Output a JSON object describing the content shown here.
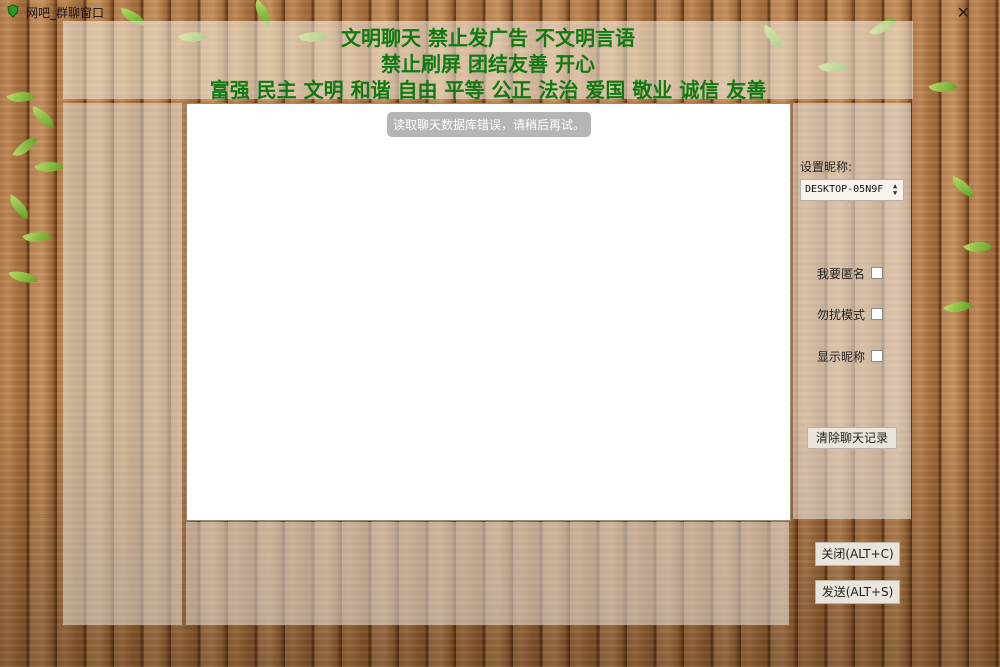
{
  "window": {
    "title": "网吧_群聊窗口",
    "close_glyph": "✕",
    "app_icon": "green-shield-icon"
  },
  "header": {
    "slogan_lines": [
      "文明聊天 禁止发广告 不文明言语",
      "禁止刷屏 团结友善 开心",
      "富强 民主 文明 和谐 自由 平等 公正 法治 爱国 敬业 诚信 友善"
    ]
  },
  "chat": {
    "toast": "读取聊天数据库错误，请稍后再试。"
  },
  "settings": {
    "nickname_label": "设置昵称:",
    "nickname_value": "DESKTOP-05N9F",
    "options": [
      {
        "label": "我要匿名",
        "checked": false
      },
      {
        "label": "勿扰模式",
        "checked": false
      },
      {
        "label": "显示昵称",
        "checked": false
      }
    ],
    "clear_label": "清除聊天记录"
  },
  "actions": {
    "close_label": "关闭(ALT+C)",
    "send_label": "发送(ALT+S)"
  },
  "colors": {
    "slogan": "#0e7a11",
    "toast_bg": "#b5b5b5"
  }
}
